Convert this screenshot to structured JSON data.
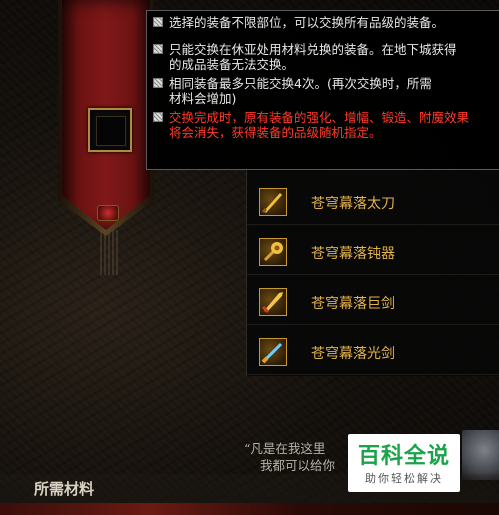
{
  "tooltip": {
    "lines": [
      {
        "text": "选择的装备不限部位，可以交换所有品级的装备。",
        "style": "normal"
      },
      {
        "text": "只能交换在休亚处用材料兑换的装备。在地下城获得",
        "style": "normal"
      },
      {
        "text": "的成品装备无法交换。",
        "style": "normal"
      },
      {
        "text": "相同装备最多只能交换4次。(再次交换时，所需",
        "style": "normal"
      },
      {
        "text": "材料会增加)",
        "style": "normal"
      },
      {
        "text": "交换完成时，原有装备的强化、增幅、锻造、附魔效果",
        "style": "warn"
      },
      {
        "text": "将会消失，获得装备的品级随机指定。",
        "style": "warn"
      }
    ]
  },
  "equipment_list": [
    {
      "name": "苍穹幕落太刀",
      "icon": "katana-icon"
    },
    {
      "name": "苍穹幕落钝器",
      "icon": "blunt-weapon-icon"
    },
    {
      "name": "苍穹幕落巨剑",
      "icon": "greatsword-icon"
    },
    {
      "name": "苍穹幕落光剑",
      "icon": "lightsaber-icon"
    }
  ],
  "npc_quote": {
    "line1": "“凡是在我这里",
    "line2": "我都可以给你"
  },
  "materials": {
    "title": "所需材料"
  },
  "watermark": {
    "title": "百科全说",
    "subtitle": "助你轻松解决"
  },
  "colors": {
    "item_name": "#e3b24a",
    "warning_text": "#ff3a2a",
    "banner_red": "#801818",
    "watermark_green": "#1aa34a"
  }
}
